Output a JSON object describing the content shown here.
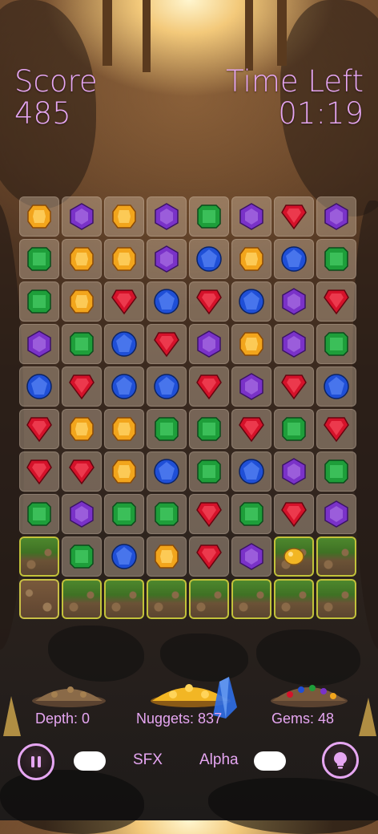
{
  "hud": {
    "score_label": "Score",
    "score_value": "485",
    "time_label": "Time Left",
    "time_value": "01:19"
  },
  "gem_colors": {
    "yellow": "#f2a51c",
    "purple": "#7a32c8",
    "green": "#1e9e3a",
    "blue": "#1f4fd6",
    "red": "#d4122a"
  },
  "board": {
    "rows": [
      [
        "yellow",
        "purple",
        "yellow",
        "purple",
        "green",
        "purple",
        "red",
        "purple"
      ],
      [
        "green",
        "yellow",
        "yellow",
        "purple",
        "blue",
        "yellow",
        "blue",
        "green"
      ],
      [
        "green",
        "yellow",
        "red",
        "blue",
        "red",
        "blue",
        "purple",
        "red"
      ],
      [
        "purple",
        "green",
        "blue",
        "red",
        "purple",
        "yellow",
        "purple",
        "green"
      ],
      [
        "blue",
        "red",
        "blue",
        "blue",
        "red",
        "purple",
        "red",
        "blue"
      ],
      [
        "red",
        "yellow",
        "yellow",
        "green",
        "green",
        "red",
        "green",
        "red"
      ],
      [
        "red",
        "red",
        "yellow",
        "blue",
        "green",
        "blue",
        "purple",
        "green"
      ],
      [
        "green",
        "purple",
        "green",
        "green",
        "red",
        "green",
        "red",
        "purple"
      ],
      [
        "dirt",
        "green",
        "blue",
        "yellow",
        "red",
        "purple",
        "dirt-nugget",
        "dirt"
      ],
      [
        "soil",
        "dirt",
        "dirt",
        "dirt",
        "dirt",
        "dirt",
        "dirt",
        "dirt"
      ]
    ]
  },
  "stats": {
    "depth": "Depth: 0",
    "nuggets": "Nuggets: 837",
    "gems": "Gems: 48"
  },
  "controls": {
    "sfx_label": "SFX",
    "alpha_label": "Alpha",
    "pause_icon": "pause-icon",
    "hint_icon": "lightbulb-icon"
  }
}
